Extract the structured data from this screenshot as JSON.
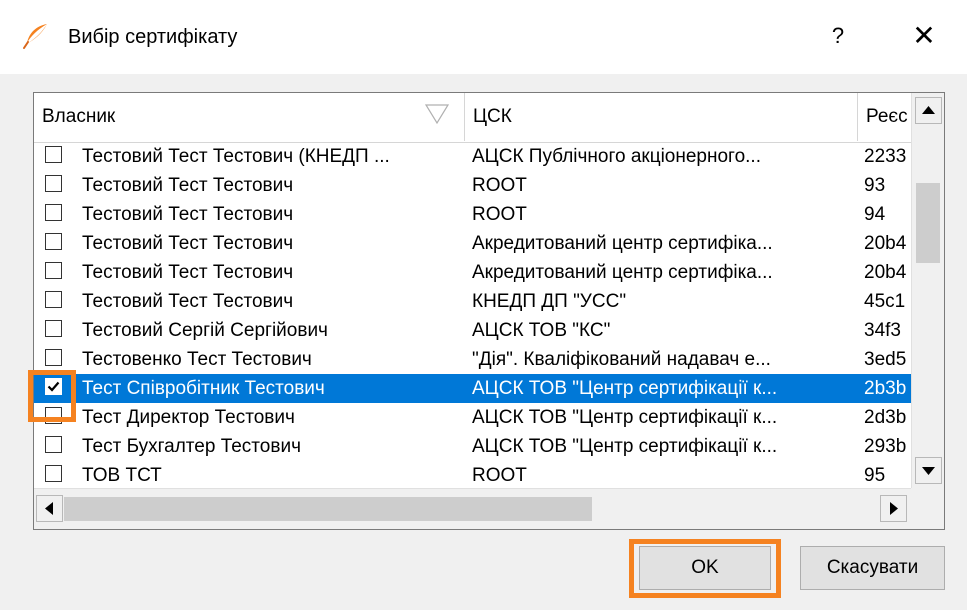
{
  "window": {
    "title": "Вибір сертифікату",
    "help": "?",
    "close": "✕"
  },
  "table": {
    "columns": [
      "Власник",
      "ЦСК",
      "Реєс"
    ],
    "rows": [
      {
        "owner": "Тестовий Тест Тестович (КНЕДП ...",
        "csk": "АЦСК Публічного акціонерного...",
        "reg": "2233",
        "checked": false,
        "selected": false
      },
      {
        "owner": "Тестовий Тест Тестович",
        "csk": "ROOT",
        "reg": "93",
        "checked": false,
        "selected": false
      },
      {
        "owner": "Тестовий Тест Тестович",
        "csk": "ROOT",
        "reg": "94",
        "checked": false,
        "selected": false
      },
      {
        "owner": "Тестовий Тест Тестович",
        "csk": "Акредитований центр сертифіка...",
        "reg": "20b4",
        "checked": false,
        "selected": false
      },
      {
        "owner": "Тестовий Тест Тестович",
        "csk": "Акредитований центр сертифіка...",
        "reg": "20b4",
        "checked": false,
        "selected": false
      },
      {
        "owner": "Тестовий Тест Тестович",
        "csk": "КНЕДП ДП \"УСС\"",
        "reg": "45c1",
        "checked": false,
        "selected": false
      },
      {
        "owner": "Тестовий Сергій Сергійович",
        "csk": "АЦСК ТОВ \"КС\"",
        "reg": "34f3",
        "checked": false,
        "selected": false
      },
      {
        "owner": "Тестовенко Тест Тестович",
        "csk": "\"Дія\". Кваліфікований надавач е...",
        "reg": "3ed5",
        "checked": false,
        "selected": false
      },
      {
        "owner": "Тест Співробітник Тестович",
        "csk": "АЦСК ТОВ \"Центр сертифікації к...",
        "reg": "2b3b",
        "checked": true,
        "selected": true
      },
      {
        "owner": "Тест Директор Тестович",
        "csk": "АЦСК ТОВ \"Центр сертифікації к...",
        "reg": "2d3b",
        "checked": false,
        "selected": false
      },
      {
        "owner": "Тест Бухгалтер Тестович",
        "csk": "АЦСК ТОВ \"Центр сертифікації к...",
        "reg": "293b",
        "checked": false,
        "selected": false
      },
      {
        "owner": "ТОВ ТСТ",
        "csk": "ROOT",
        "reg": "95",
        "checked": false,
        "selected": false
      }
    ]
  },
  "buttons": {
    "ok": "OK",
    "cancel": "Скасувати"
  },
  "colors": {
    "selection": "#0078d7",
    "highlight": "#f58220",
    "app_icon": "#f58220"
  }
}
